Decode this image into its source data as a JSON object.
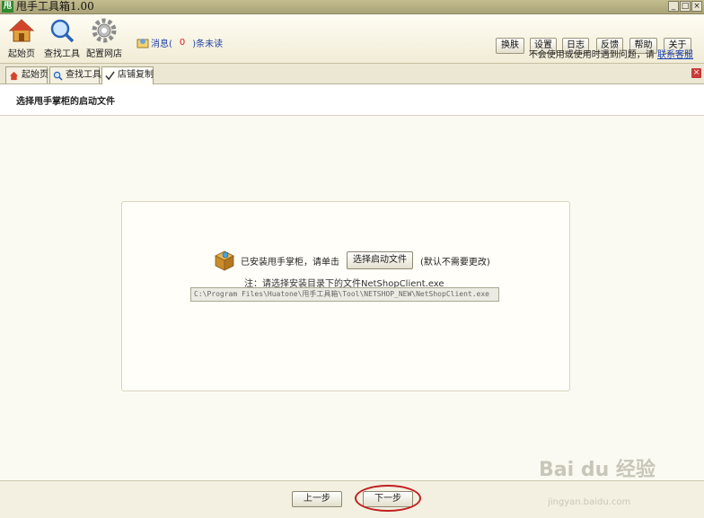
{
  "window": {
    "title": "甩手工具箱1.00",
    "app_icon": "甩"
  },
  "toolbar": {
    "tools": [
      {
        "label": "起始页",
        "icon": "home-icon"
      },
      {
        "label": "查找工具",
        "icon": "magnifier-icon"
      },
      {
        "label": "配置网店",
        "icon": "gear-icon"
      }
    ],
    "message_prefix": "消息(",
    "message_count": "0",
    "message_suffix": ")条未读",
    "buttons": [
      "换肤",
      "设置",
      "日志",
      "反馈",
      "帮助",
      "关于"
    ],
    "help_text": "不会使用或使用时遇到问题，请",
    "contact_link": "联系客服"
  },
  "tabs": [
    {
      "label": "起始页",
      "icon": "home-icon"
    },
    {
      "label": "查找工具",
      "icon": "magnifier-icon"
    },
    {
      "label": "店铺复制",
      "icon": "checkmark-icon",
      "active": true
    }
  ],
  "page": {
    "section_title": "选择甩手掌柜的启动文件",
    "installed_text": "已安装甩手掌柜，请单击",
    "choose_button": "选择启动文件",
    "default_hint": "(默认不需要更改)",
    "note": "注：请选择安装目录下的文件NetShopClient.exe",
    "path_value": "C:\\Program Files\\Huatone\\甩手工具箱\\Tool\\NETSHOP_NEW\\NetShopClient.exe"
  },
  "footer": {
    "prev_button": "上一步",
    "next_button": "下一步"
  },
  "watermark": {
    "text": "Bai du 经验",
    "sub": "jingyan.baidu.com"
  },
  "colors": {
    "accent_red": "#c11f1f",
    "link_blue": "#1a3fb3",
    "message_count": "#d31c1c"
  }
}
